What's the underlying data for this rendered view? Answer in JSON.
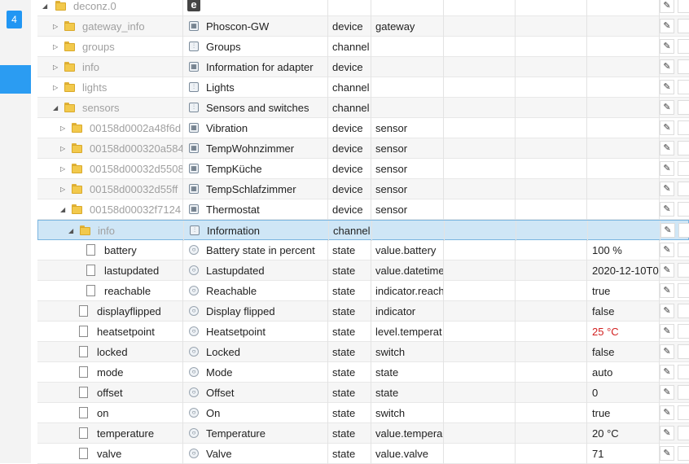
{
  "sidebar": {
    "badge": "4"
  },
  "root": {
    "id": "deconz.0",
    "logo_icon": "e"
  },
  "rows": [
    {
      "id": "gateway_info",
      "name": "Phoscon-GW",
      "type": "device",
      "role": "gateway",
      "value": "",
      "depth": 1,
      "kind": "folder",
      "caret": "closed",
      "icon": "device-icon",
      "muted": true
    },
    {
      "id": "groups",
      "name": "Groups",
      "type": "channel",
      "role": "",
      "value": "",
      "depth": 1,
      "kind": "folder",
      "caret": "closed",
      "icon": "channel-icon",
      "muted": true
    },
    {
      "id": "info",
      "name": "Information for adapter",
      "type": "device",
      "role": "",
      "value": "",
      "depth": 1,
      "kind": "folder",
      "caret": "closed",
      "icon": "device-icon",
      "muted": true
    },
    {
      "id": "lights",
      "name": "Lights",
      "type": "channel",
      "role": "",
      "value": "",
      "depth": 1,
      "kind": "folder",
      "caret": "closed",
      "icon": "channel-icon",
      "muted": true
    },
    {
      "id": "sensors",
      "name": "Sensors and switches",
      "type": "channel",
      "role": "",
      "value": "",
      "depth": 1,
      "kind": "folder",
      "caret": "open",
      "icon": "channel-icon",
      "muted": true
    },
    {
      "id": "00158d0002a48f6d",
      "name": "Vibration",
      "type": "device",
      "role": "sensor",
      "value": "",
      "depth": 2,
      "kind": "folder",
      "caret": "closed",
      "icon": "device-icon",
      "muted": true
    },
    {
      "id": "00158d000320a584",
      "name": "TempWohnzimmer",
      "type": "device",
      "role": "sensor",
      "value": "",
      "depth": 2,
      "kind": "folder",
      "caret": "closed",
      "icon": "device-icon",
      "muted": true
    },
    {
      "id": "00158d00032d5508",
      "name": "TempKüche",
      "type": "device",
      "role": "sensor",
      "value": "",
      "depth": 2,
      "kind": "folder",
      "caret": "closed",
      "icon": "device-icon",
      "muted": true
    },
    {
      "id": "00158d00032d55ff",
      "name": "TempSchlafzimmer",
      "type": "device",
      "role": "sensor",
      "value": "",
      "depth": 2,
      "kind": "folder",
      "caret": "closed",
      "icon": "device-icon",
      "muted": true
    },
    {
      "id": "00158d00032f7124",
      "name": "Thermostat",
      "type": "device",
      "role": "sensor",
      "value": "",
      "depth": 2,
      "kind": "folder",
      "caret": "open",
      "icon": "device-icon",
      "muted": true
    },
    {
      "id": "info",
      "name": "Information",
      "type": "channel",
      "role": "",
      "value": "",
      "depth": 3,
      "kind": "folder",
      "caret": "open",
      "icon": "channel-icon",
      "muted": true,
      "selected": true
    },
    {
      "id": "battery",
      "name": "Battery state in percent",
      "type": "state",
      "role": "value.battery",
      "value": "100 %",
      "depth": 4,
      "kind": "file",
      "icon": "state-icon"
    },
    {
      "id": "lastupdated",
      "name": "Lastupdated",
      "type": "state",
      "role": "value.datetime",
      "value": "2020-12-10T0",
      "depth": 4,
      "kind": "file",
      "icon": "state-icon"
    },
    {
      "id": "reachable",
      "name": "Reachable",
      "type": "state",
      "role": "indicator.reach",
      "value": "true",
      "depth": 4,
      "kind": "file",
      "icon": "state-icon"
    },
    {
      "id": "displayflipped",
      "name": "Display flipped",
      "type": "state",
      "role": "indicator",
      "value": "false",
      "depth": 3,
      "kind": "file",
      "icon": "state-icon"
    },
    {
      "id": "heatsetpoint",
      "name": "Heatsetpoint",
      "type": "state",
      "role": "level.temperat",
      "value": "25 °C",
      "depth": 3,
      "kind": "file",
      "icon": "state-icon",
      "value_red": true
    },
    {
      "id": "locked",
      "name": "Locked",
      "type": "state",
      "role": "switch",
      "value": "false",
      "depth": 3,
      "kind": "file",
      "icon": "state-icon"
    },
    {
      "id": "mode",
      "name": "Mode",
      "type": "state",
      "role": "state",
      "value": "auto",
      "depth": 3,
      "kind": "file",
      "icon": "state-icon"
    },
    {
      "id": "offset",
      "name": "Offset",
      "type": "state",
      "role": "state",
      "value": "0",
      "depth": 3,
      "kind": "file",
      "icon": "state-icon"
    },
    {
      "id": "on",
      "name": "On",
      "type": "state",
      "role": "switch",
      "value": "true",
      "depth": 3,
      "kind": "file",
      "icon": "state-icon"
    },
    {
      "id": "temperature",
      "name": "Temperature",
      "type": "state",
      "role": "value.tempera",
      "value": "20 °C",
      "depth": 3,
      "kind": "file",
      "icon": "state-icon"
    },
    {
      "id": "valve",
      "name": "Valve",
      "type": "state",
      "role": "value.valve",
      "value": "71",
      "depth": 3,
      "kind": "file",
      "icon": "state-icon"
    }
  ],
  "actions": {
    "edit_icon": "✎"
  },
  "colors": {
    "accent": "#2196f3",
    "selected_row": "#cfe6f6",
    "folder": "#f2c94c",
    "warning_value": "#d21f1f"
  }
}
